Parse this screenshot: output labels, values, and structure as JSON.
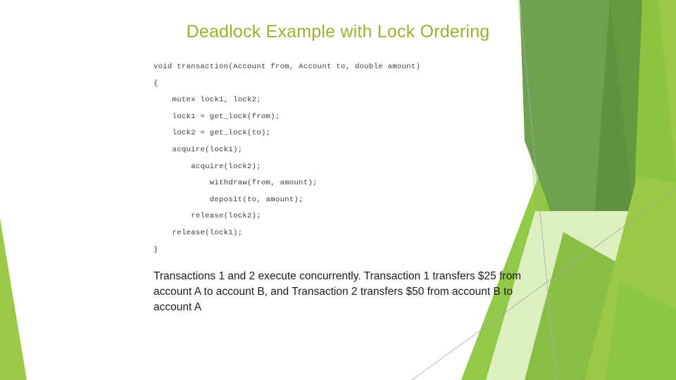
{
  "slide": {
    "title": "Deadlock Example with Lock Ordering",
    "title_color": "#9BB033",
    "background_color": "#FFFFFF",
    "body_text_color": "#1C1C1C",
    "code_text_color": "#3B3B3B"
  },
  "code": {
    "lines": [
      "void transaction(Account from, Account to, double amount)",
      "{",
      "    mutex lock1, lock2;",
      "    lock1 = get_lock(from);",
      "    lock2 = get_lock(to);",
      "    acquire(lock1);",
      "        acquire(lock2);",
      "            withdraw(from, amount);",
      "            deposit(to, amount);",
      "        release(lock2);",
      "    release(lock1);",
      "}"
    ]
  },
  "body": {
    "paragraph": "Transactions 1 and 2 execute concurrently.  Transaction  1 transfers $25 from account A to account B, and Transaction 2 transfers $50 from account B to account A"
  },
  "decoration": {
    "theme_name": "facet",
    "colors": {
      "bright_green": "#9BC845",
      "sage_green": "#6FA04F",
      "mid_green": "#7FB739",
      "light_green": "#8CC63E",
      "pale_green": "#DCEFBE",
      "soft_green": "#BDDC8C",
      "deep_green": "#5E8F3F",
      "hairline_gray": "#A9A9A9"
    }
  }
}
